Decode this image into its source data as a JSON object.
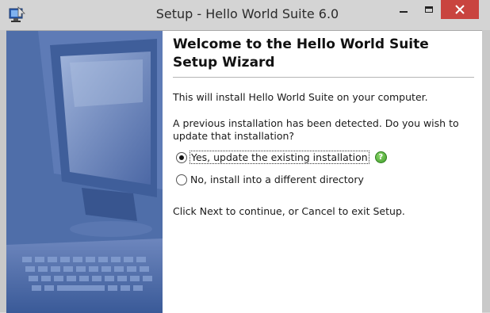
{
  "window": {
    "title": "Setup - Hello World Suite 6.0",
    "icons": {
      "app": "setup-installer-icon",
      "minimize": "minimize-icon",
      "maximize": "maximize-icon",
      "close": "close-icon"
    },
    "close_color": "#c9443f"
  },
  "wizard": {
    "heading": "Welcome to the Hello World Suite Setup Wizard",
    "intro": "This will install Hello World Suite on your computer.",
    "prompt": "A previous installation has been detected. Do you wish to update that installation?",
    "options": [
      {
        "label": "Yes, update the existing installation",
        "selected": true
      },
      {
        "label": "No, install into a different directory",
        "selected": false
      }
    ],
    "help_icon": "help-question-icon",
    "help_glyph": "?",
    "footer": "Click Next to continue, or Cancel to exit Setup."
  }
}
